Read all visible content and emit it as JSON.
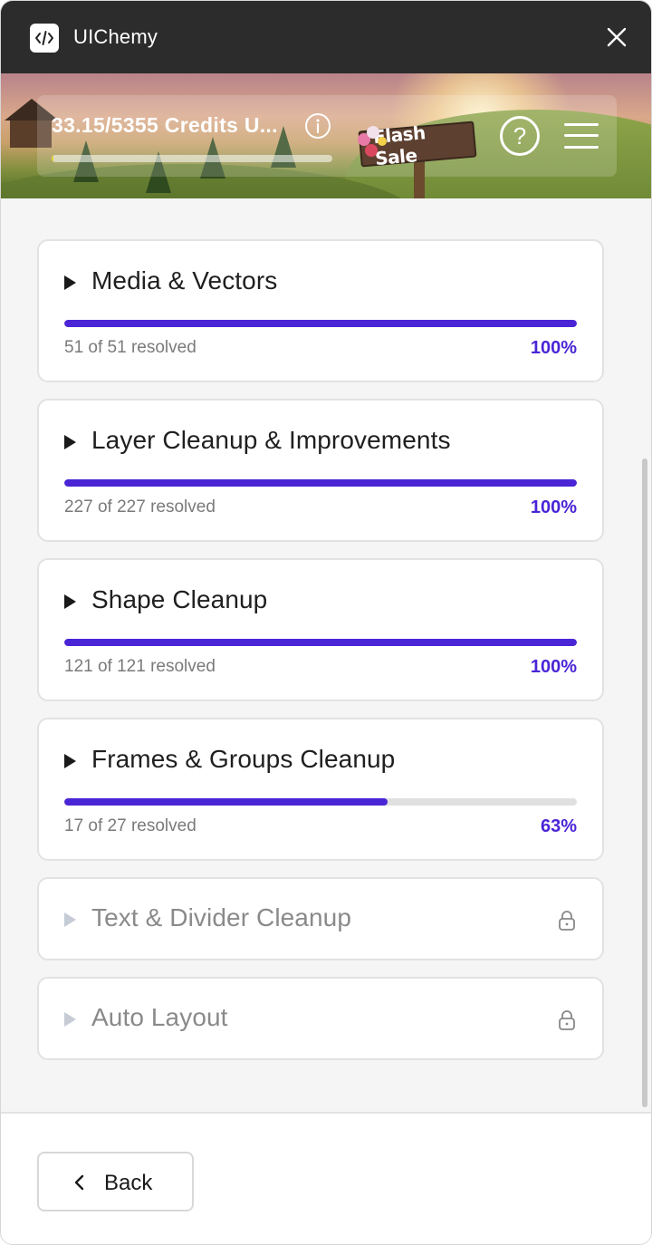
{
  "app": {
    "name": "UIChemy",
    "logo_icon": "code-icon",
    "close_icon": "close-icon"
  },
  "banner": {
    "credits_text": "33.15/5355 Credits U...",
    "credits_used_fraction": 0.006,
    "info_icon": "info-icon",
    "flash_sale_label": "Flash Sale",
    "help_icon": "question-circle-icon",
    "menu_icon": "hamburger-menu-icon"
  },
  "sections": [
    {
      "title": "Media & Vectors",
      "status": "51 of 51 resolved",
      "percent": "100%",
      "progress": 1.0,
      "locked": false
    },
    {
      "title": "Layer Cleanup & Improvements",
      "status": "227 of 227 resolved",
      "percent": "100%",
      "progress": 1.0,
      "locked": false
    },
    {
      "title": "Shape Cleanup",
      "status": "121 of 121 resolved",
      "percent": "100%",
      "progress": 1.0,
      "locked": false
    },
    {
      "title": "Frames & Groups Cleanup",
      "status": "17 of 27 resolved",
      "percent": "63%",
      "progress": 0.63,
      "locked": false
    },
    {
      "title": "Text & Divider Cleanup",
      "locked": true
    },
    {
      "title": "Auto Layout",
      "locked": true
    }
  ],
  "footer": {
    "back_label": "Back",
    "back_icon": "chevron-left-icon"
  },
  "colors": {
    "accent": "#4a25d6",
    "titlebar": "#2c2c2c",
    "track": "#e0e0e0",
    "locked_text": "#8a8a8a"
  }
}
